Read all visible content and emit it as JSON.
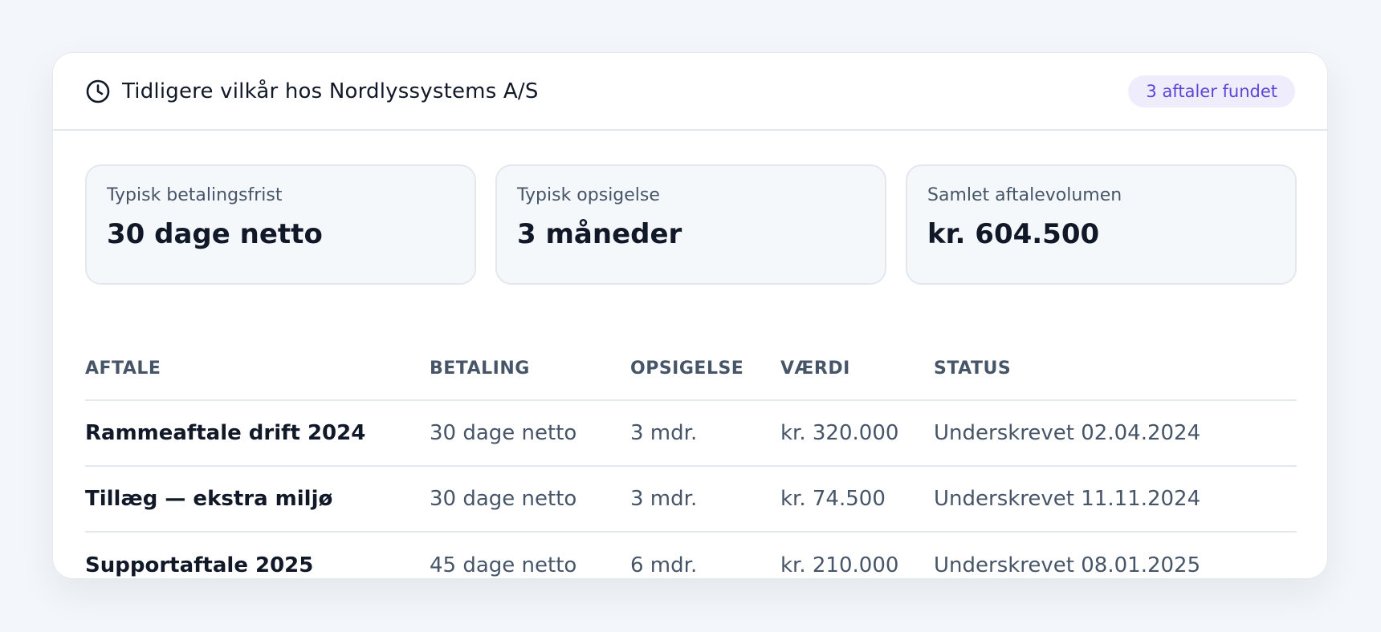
{
  "header": {
    "title": "Tidligere vilkår hos Nordlyssystems A/S",
    "badge": "3 aftaler fundet",
    "icon": "clock-icon"
  },
  "stats": [
    {
      "label": "Typisk betalingsfrist",
      "value": "30 dage netto"
    },
    {
      "label": "Typisk opsigelse",
      "value": "3 måneder"
    },
    {
      "label": "Samlet aftalevolumen",
      "value": "kr. 604.500"
    }
  ],
  "table": {
    "columns": [
      "AFTALE",
      "BETALING",
      "OPSIGELSE",
      "VÆRDI",
      "STATUS"
    ],
    "rows": [
      {
        "aftale": "Rammeaftale drift 2024",
        "betaling": "30 dage netto",
        "opsigelse": "3 mdr.",
        "vaerdi": "kr. 320.000",
        "status": "Underskrevet 02.04.2024"
      },
      {
        "aftale": "Tillæg — ekstra miljø",
        "betaling": "30 dage netto",
        "opsigelse": "3 mdr.",
        "vaerdi": "kr. 74.500",
        "status": "Underskrevet 11.11.2024"
      },
      {
        "aftale": "Supportaftale 2025",
        "betaling": "45 dage netto",
        "opsigelse": "6 mdr.",
        "vaerdi": "kr. 210.000",
        "status": "Underskrevet 08.01.2025"
      }
    ]
  },
  "colors": {
    "accent": "#5b45d6",
    "badge_bg": "#efedfb",
    "text_primary": "#111827",
    "text_secondary": "#475569",
    "border": "#e3e8ef",
    "page_bg": "#f3f6fa"
  }
}
